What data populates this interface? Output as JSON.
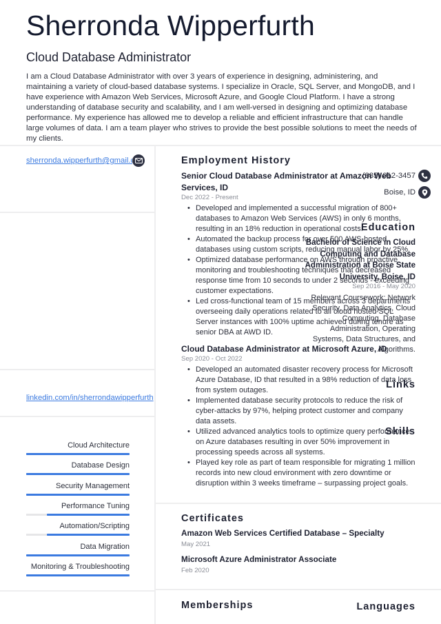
{
  "header": {
    "name": "Sherronda Wipperfurth",
    "title": "Cloud Database Administrator",
    "summary": "I am a Cloud Database Administrator with over 3 years of experience in designing, administering, and maintaining a variety of cloud-based database systems. I specialize in Oracle, SQL Server, and MongoDB, and I have experience with Amazon Web Services, Microsoft Azure, and Google Cloud Platform. I have a strong understanding of database security and scalability, and I am well-versed in designing and optimizing database performance. My experience has allowed me to develop a reliable and efficient infrastructure that can handle large volumes of data. I am a team player who strives to provide the best possible solutions to meet the needs of my clients."
  },
  "contact": {
    "email": "sherronda.wipperfurth@gmail.com",
    "phone": "(885) 012-3457",
    "location": "Boise, ID",
    "icons": {
      "email": "envelope-icon",
      "phone": "phone-icon",
      "location": "map-pin-icon"
    }
  },
  "education": {
    "heading": "Education",
    "degree": "Bachelor of Science in Cloud Computing and Database Administration at Boise State University, Boise, ID",
    "dates": "Sep 2016 - May 2020",
    "description": "Relevant Coursework: Network Security, Data Analytics, Cloud Computing, Database Administration, Operating Systems, Data Structures, and Algorithms."
  },
  "links": {
    "heading": "Links",
    "items": [
      "linkedin.com/in/sherrondawipperfurth"
    ]
  },
  "skills": {
    "heading": "Skills",
    "accent_color": "#3b7ae0",
    "items": [
      {
        "label": "Cloud Architecture",
        "level": 1.0
      },
      {
        "label": "Database Design",
        "level": 1.0
      },
      {
        "label": "Security Management",
        "level": 1.0
      },
      {
        "label": "Performance Tuning",
        "level": 0.8
      },
      {
        "label": "Automation/Scripting",
        "level": 0.8
      },
      {
        "label": "Data Migration",
        "level": 1.0
      },
      {
        "label": "Monitoring & Troubleshooting",
        "level": 1.0
      }
    ]
  },
  "languages": {
    "heading": "Languages"
  },
  "employment": {
    "heading": "Employment History",
    "jobs": [
      {
        "title": "Senior Cloud Database Administrator at Amazon Web Services, ID",
        "dates": "Dec 2022 - Present",
        "bullets": [
          "Developed and implemented a successful migration of 800+ databases to Amazon Web Services (AWS) in only 6 months, resulting in an 18% reduction in operational costs.",
          "Automated the backup process for over 500 AWS-hosted databases using custom scripts, reducing manual labor by 25%.",
          "Optimized database performance on AWS through proactive monitoring and troubleshooting techniques that decreased response time from 10 seconds to under 2 seconds - exceeding customer expectations.",
          "Led cross-functional team of 15 members across 3 departments overseeing daily operations related to all cloud hosted SQL Server instances with 100% uptime achieved during tenure as senior DBA at AWD ID."
        ]
      },
      {
        "title": "Cloud Database Administrator at Microsoft Azure, ID",
        "dates": "Sep 2020 - Oct 2022",
        "bullets": [
          "Developed an automated disaster recovery process for Microsoft Azure Database, ID that resulted in a 98% reduction of data loss from system outages.",
          "Implemented database security protocols to reduce the risk of cyber-attacks by 97%, helping protect customer and company data assets.",
          "Utilized advanced analytics tools to optimize query performance on Azure databases resulting in over 50% improvement in processing speeds across all systems.",
          "Played key role as part of team responsible for migrating 1 million records into new cloud environment with zero downtime or disruption within 3 weeks timeframe – surpassing project goals."
        ]
      }
    ]
  },
  "certificates": {
    "heading": "Certificates",
    "items": [
      {
        "name": "Amazon Web Services Certified Database – Specialty",
        "date": "May 2021"
      },
      {
        "name": "Microsoft Azure Administrator Associate",
        "date": "Feb 2020"
      }
    ]
  },
  "memberships": {
    "heading": "Memberships"
  }
}
